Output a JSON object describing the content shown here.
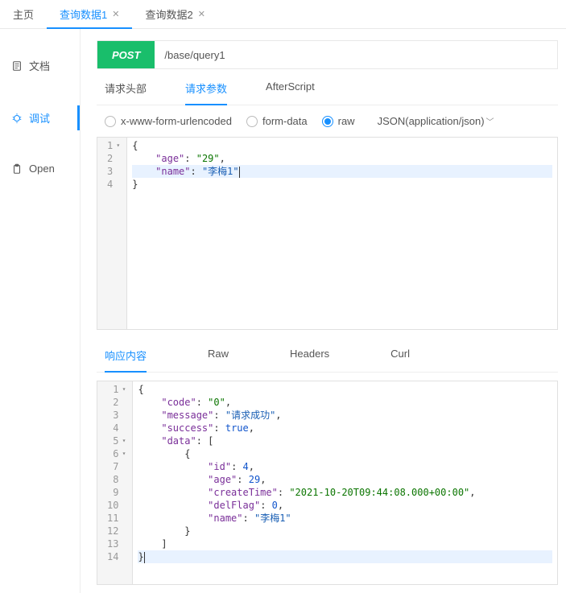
{
  "top_tabs": [
    {
      "label": "主页",
      "closable": false,
      "active": false
    },
    {
      "label": "查询数据1",
      "closable": true,
      "active": true
    },
    {
      "label": "查询数据2",
      "closable": true,
      "active": false
    }
  ],
  "sidebar": {
    "items": [
      {
        "label": "文档",
        "icon": "document",
        "active": false
      },
      {
        "label": "调试",
        "icon": "bug",
        "active": true
      },
      {
        "label": "Open",
        "icon": "clipboard",
        "active": false
      }
    ]
  },
  "request": {
    "method": "POST",
    "url": "/base/query1",
    "sub_tabs": [
      "请求头部",
      "请求参数",
      "AfterScript"
    ],
    "sub_tab_active": 1,
    "body_types": [
      "x-www-form-urlencoded",
      "form-data",
      "raw"
    ],
    "body_type_selected": "raw",
    "content_type_label": "JSON(application/json)",
    "body_lines": [
      {
        "n": 1,
        "fold": true,
        "hl": false,
        "tokens": [
          {
            "t": "{",
            "c": "punc"
          }
        ]
      },
      {
        "n": 2,
        "fold": false,
        "hl": false,
        "tokens": [
          {
            "t": "    ",
            "c": ""
          },
          {
            "t": "\"age\"",
            "c": "key"
          },
          {
            "t": ": ",
            "c": "punc"
          },
          {
            "t": "\"29\"",
            "c": "str"
          },
          {
            "t": ",",
            "c": "punc"
          }
        ]
      },
      {
        "n": 3,
        "fold": false,
        "hl": true,
        "tokens": [
          {
            "t": "    ",
            "c": ""
          },
          {
            "t": "\"name\"",
            "c": "key"
          },
          {
            "t": ": ",
            "c": "punc"
          },
          {
            "t": "\"李梅1\"",
            "c": "str-cjk"
          }
        ],
        "cursor_after": true
      },
      {
        "n": 4,
        "fold": false,
        "hl": false,
        "tokens": [
          {
            "t": "}",
            "c": "punc"
          }
        ]
      }
    ]
  },
  "response": {
    "tabs": [
      "响应内容",
      "Raw",
      "Headers",
      "Curl"
    ],
    "tab_active": 0,
    "lines": [
      {
        "n": 1,
        "fold": true,
        "hl": false,
        "tokens": [
          {
            "t": "{",
            "c": "punc"
          }
        ]
      },
      {
        "n": 2,
        "fold": false,
        "hl": false,
        "tokens": [
          {
            "t": "    ",
            "c": ""
          },
          {
            "t": "\"code\"",
            "c": "key"
          },
          {
            "t": ": ",
            "c": "punc"
          },
          {
            "t": "\"0\"",
            "c": "str"
          },
          {
            "t": ",",
            "c": "punc"
          }
        ]
      },
      {
        "n": 3,
        "fold": false,
        "hl": false,
        "tokens": [
          {
            "t": "    ",
            "c": ""
          },
          {
            "t": "\"message\"",
            "c": "key"
          },
          {
            "t": ": ",
            "c": "punc"
          },
          {
            "t": "\"请求成功\"",
            "c": "str-cjk"
          },
          {
            "t": ",",
            "c": "punc"
          }
        ]
      },
      {
        "n": 4,
        "fold": false,
        "hl": false,
        "tokens": [
          {
            "t": "    ",
            "c": ""
          },
          {
            "t": "\"success\"",
            "c": "key"
          },
          {
            "t": ": ",
            "c": "punc"
          },
          {
            "t": "true",
            "c": "bool"
          },
          {
            "t": ",",
            "c": "punc"
          }
        ]
      },
      {
        "n": 5,
        "fold": true,
        "hl": false,
        "tokens": [
          {
            "t": "    ",
            "c": ""
          },
          {
            "t": "\"data\"",
            "c": "key"
          },
          {
            "t": ": [",
            "c": "punc"
          }
        ]
      },
      {
        "n": 6,
        "fold": true,
        "hl": false,
        "tokens": [
          {
            "t": "        {",
            "c": "punc"
          }
        ]
      },
      {
        "n": 7,
        "fold": false,
        "hl": false,
        "tokens": [
          {
            "t": "            ",
            "c": ""
          },
          {
            "t": "\"id\"",
            "c": "key"
          },
          {
            "t": ": ",
            "c": "punc"
          },
          {
            "t": "4",
            "c": "num"
          },
          {
            "t": ",",
            "c": "punc"
          }
        ]
      },
      {
        "n": 8,
        "fold": false,
        "hl": false,
        "tokens": [
          {
            "t": "            ",
            "c": ""
          },
          {
            "t": "\"age\"",
            "c": "key"
          },
          {
            "t": ": ",
            "c": "punc"
          },
          {
            "t": "29",
            "c": "num"
          },
          {
            "t": ",",
            "c": "punc"
          }
        ]
      },
      {
        "n": 9,
        "fold": false,
        "hl": false,
        "tokens": [
          {
            "t": "            ",
            "c": ""
          },
          {
            "t": "\"createTime\"",
            "c": "key"
          },
          {
            "t": ": ",
            "c": "punc"
          },
          {
            "t": "\"2021-10-20T09:44:08.000+00:00\"",
            "c": "str"
          },
          {
            "t": ",",
            "c": "punc"
          }
        ]
      },
      {
        "n": 10,
        "fold": false,
        "hl": false,
        "tokens": [
          {
            "t": "            ",
            "c": ""
          },
          {
            "t": "\"delFlag\"",
            "c": "key"
          },
          {
            "t": ": ",
            "c": "punc"
          },
          {
            "t": "0",
            "c": "num"
          },
          {
            "t": ",",
            "c": "punc"
          }
        ]
      },
      {
        "n": 11,
        "fold": false,
        "hl": false,
        "tokens": [
          {
            "t": "            ",
            "c": ""
          },
          {
            "t": "\"name\"",
            "c": "key"
          },
          {
            "t": ": ",
            "c": "punc"
          },
          {
            "t": "\"李梅1\"",
            "c": "str-cjk"
          }
        ]
      },
      {
        "n": 12,
        "fold": false,
        "hl": false,
        "tokens": [
          {
            "t": "        }",
            "c": "punc"
          }
        ]
      },
      {
        "n": 13,
        "fold": false,
        "hl": false,
        "tokens": [
          {
            "t": "    ]",
            "c": "punc"
          }
        ]
      },
      {
        "n": 14,
        "fold": false,
        "hl": true,
        "tokens": [
          {
            "t": "}",
            "c": "punc"
          }
        ],
        "cursor_after": true
      }
    ]
  }
}
